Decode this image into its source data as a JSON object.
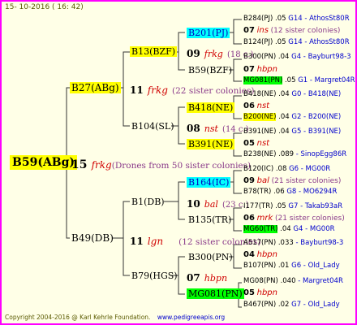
{
  "header": {
    "date": "15- 10-2016 ( 16: 42)"
  },
  "root": {
    "name": "B59(ABg)",
    "count": "15",
    "family": "frkg",
    "note": "(Drones from 50 sister colonies)"
  },
  "mother": {
    "name": "B27(ABg)",
    "count": "11",
    "family": "frkg",
    "note": "(22 sister colonies)"
  },
  "father": {
    "name": "B49(DB)",
    "count": "11",
    "family": "lgn",
    "note": "(12 sister colonies)"
  },
  "gen2": {
    "b13": {
      "name": "B13(BZF)",
      "count": "09",
      "family": "frkg",
      "note": "(18 c.)"
    },
    "b104": {
      "name": "B104(SL)",
      "count": "08",
      "family": "nst",
      "note": "(14 c.)"
    },
    "b1": {
      "name": "B1(DB)",
      "count": "10",
      "family": "bal",
      "note": "(23 c.)"
    },
    "b79": {
      "name": "B79(HGS)",
      "count": "07",
      "family": "hbpn",
      "note": ""
    }
  },
  "gen3": {
    "b201": "B201(PJ)",
    "b59bzf": "B59(BZF)",
    "b418": "B418(NE)",
    "b391": "B391(NE)",
    "b164": "B164(IC)",
    "b135": "B135(TR)",
    "b300": "B300(PN)",
    "mg081": "MG081(PN)"
  },
  "gen4": [
    {
      "a": "B284(PJ)",
      "b": ".05",
      "c": "G14 - AthosSt80R"
    },
    {
      "num": "07",
      "fam": "ins",
      "note": "(12 sister colonies)"
    },
    {
      "a": "B124(PJ)",
      "b": ".05",
      "c": "G14 - AthosSt80R"
    },
    {
      "a": "B300(PN)",
      "b": ".04",
      "c": "G4 - Bayburt98-3"
    },
    {
      "num": "07",
      "fam": "hbpn",
      "note": ""
    },
    {
      "a": "MG081(PN)",
      "b": ".05",
      "c": "G1 - Margret04R"
    },
    {
      "a": "B418(NE)",
      "b": ".04",
      "c": "G0 - B418(NE)"
    },
    {
      "num": "06",
      "fam": "nst",
      "note": ""
    },
    {
      "a": "B200(NE)",
      "b": ".04",
      "c": "G2 - B200(NE)"
    },
    {
      "a": "B391(NE)",
      "b": ".04",
      "c": "G5 - B391(NE)"
    },
    {
      "num": "05",
      "fam": "nst",
      "note": ""
    },
    {
      "a": "B238(NE)",
      "b": ".089",
      "c": "- SinopEgg86R"
    },
    {
      "a": "B120(IC)",
      "b": ".08",
      "c": "G6 - MG00R"
    },
    {
      "num": "09",
      "fam": "bal",
      "note": "(21 sister colonies)"
    },
    {
      "a": "B78(TR)",
      "b": ".06",
      "c": "G8 - MO6294R"
    },
    {
      "a": "I177(TR)",
      "b": ".05",
      "c": "G7 - Takab93aR"
    },
    {
      "num": "06",
      "fam": "mrk",
      "note": "(21 sister colonies)"
    },
    {
      "a": "MG60(TR)",
      "b": ".04",
      "c": "G4 - MG00R"
    },
    {
      "a": "A517(PN)",
      "b": ".033",
      "c": "- Bayburt98-3"
    },
    {
      "num": "04",
      "fam": "hbpn",
      "note": ""
    },
    {
      "a": "B107(PN)",
      "b": ".01",
      "c": "G6 - Old_Lady"
    },
    {
      "a": "MG08(PN)",
      "b": ".040",
      "c": "- Margret04R"
    },
    {
      "num": "05",
      "fam": "hbpn",
      "note": ""
    },
    {
      "a": "B467(PN)",
      "b": ".02",
      "c": "G7 - Old_Lady"
    }
  ],
  "footer": {
    "copyright": "Copyright 2004-2016 @ Karl Kehrle Foundation.",
    "url": "www.pedigreeapis.org"
  },
  "colors": {
    "frame": "#ff00ff",
    "background": "#ffffe7",
    "highlight_yellow": "#ffff00",
    "highlight_cyan": "#00ffff",
    "highlight_green": "#00ff00",
    "family_red": "#d00000",
    "link_blue": "#0000cc"
  }
}
